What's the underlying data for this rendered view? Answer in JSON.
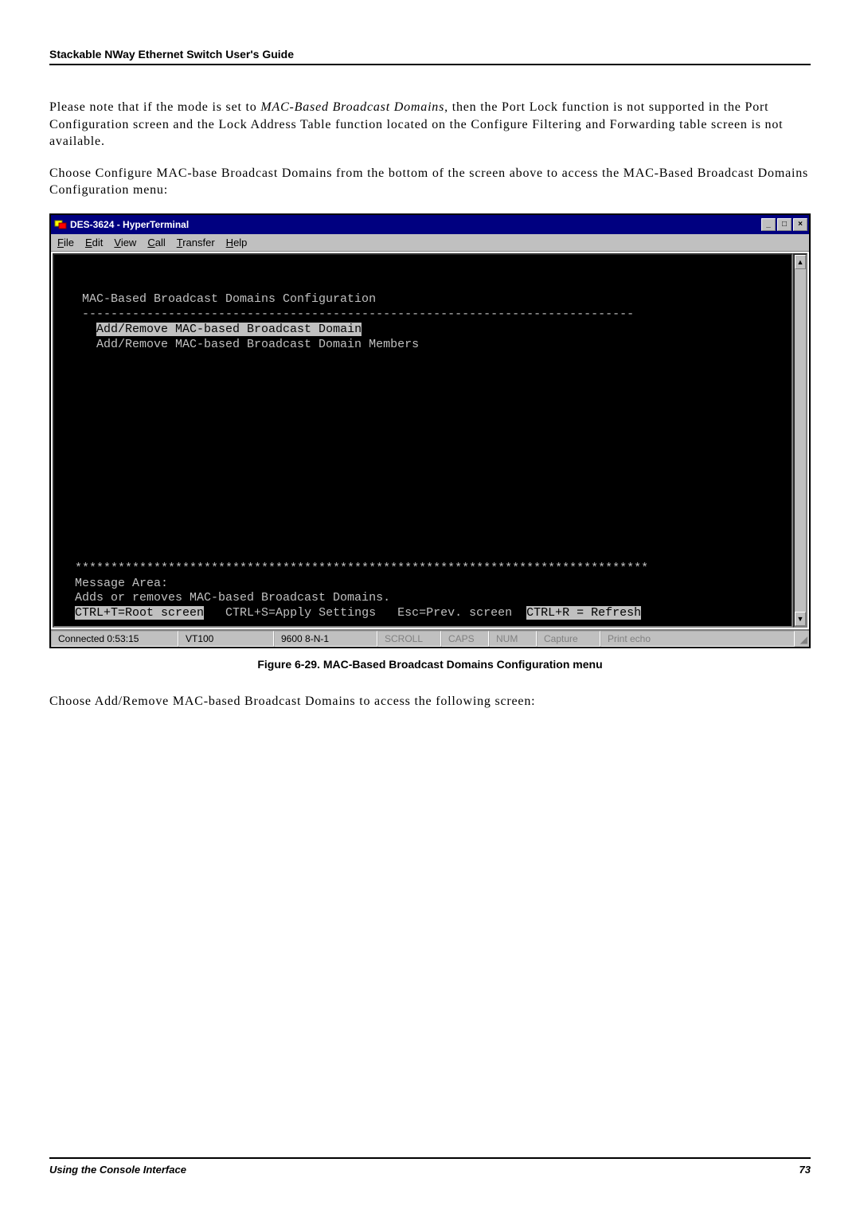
{
  "header": {
    "title": "Stackable NWay Ethernet Switch User's Guide"
  },
  "paragraphs": {
    "p1_a": "Please note that if the mode is set to ",
    "p1_i": "MAC-Based Broadcast Domains",
    "p1_b": ", then the Port Lock function is not supported in the Port Configuration screen and the Lock Address Table function located on the Configure Filtering and Forwarding table screen is not available.",
    "p2": "Choose Configure MAC-base Broadcast Domains from the bottom of the screen above to access the MAC-Based Broadcast Domains Configuration menu:",
    "p3": "Choose Add/Remove MAC-based Broadcast Domains to access the following screen:"
  },
  "window": {
    "title": "DES-3624 - HyperTerminal",
    "controls": {
      "min": "_",
      "max": "□",
      "close": "×"
    },
    "menu": [
      "File",
      "Edit",
      "View",
      "Call",
      "Transfer",
      "Help"
    ],
    "terminal": {
      "heading": "   MAC-Based Broadcast Domains Configuration",
      "dashline": "   -----------------------------------------------------------------------------",
      "line_sel": "Add/Remove MAC-based Broadcast Domain",
      "line2": "     Add/Remove MAC-based Broadcast Domain Members",
      "stars": "  ********************************************************************************",
      "msgarea": "  Message Area:",
      "msg": "  Adds or removes MAC-based Broadcast Domains.",
      "help_a": "CTRL+T=Root screen",
      "help_b": "   CTRL+S=Apply Settings   Esc=Prev. screen  ",
      "help_c": "CTRL+R = Refresh"
    },
    "scroll": {
      "up": "▲",
      "down": "▼"
    },
    "status": {
      "conn": "Connected 0:53:15",
      "emul": "VT100",
      "baud": "9600 8-N-1",
      "scroll": "SCROLL",
      "caps": "CAPS",
      "num": "NUM",
      "capture": "Capture",
      "echo": "Print echo"
    }
  },
  "figure": {
    "caption": "Figure 6-29.  MAC-Based Broadcast Domains Configuration menu"
  },
  "footer": {
    "section": "Using the Console Interface",
    "page": "73"
  }
}
